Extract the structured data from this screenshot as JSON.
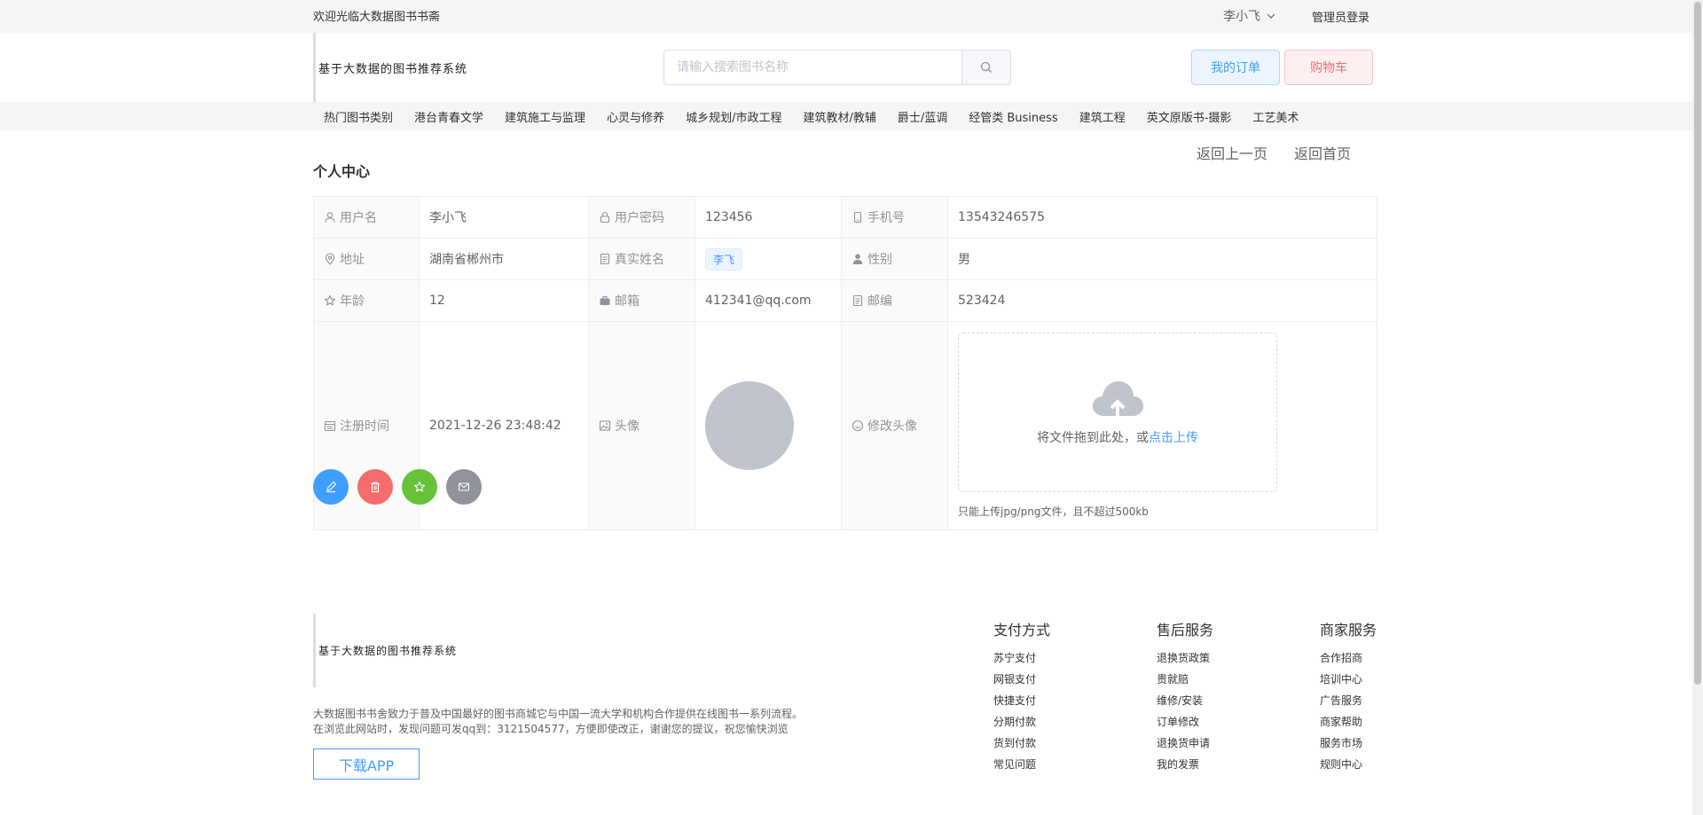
{
  "topbar": {
    "welcome": "欢迎光临大数据图书书斋",
    "username": "李小飞",
    "admin_login": "管理员登录"
  },
  "header": {
    "logo": "基于大数据的图书推荐系统",
    "search_placeholder": "请输入搜索图书名称",
    "orders": "我的订单",
    "cart": "购物车"
  },
  "categories": [
    "热门图书类别",
    "港台青春文学",
    "建筑施工与监理",
    "心灵与修养",
    "城乡规划/市政工程",
    "建筑教材/教辅",
    "爵士/蓝调",
    "经管类 Business",
    "建筑工程",
    "英文原版书-摄影",
    "工艺美术"
  ],
  "page": {
    "title": "个人中心",
    "back": "返回上一页",
    "home": "返回首页"
  },
  "profile": {
    "username_label": "用户名",
    "username": "李小飞",
    "password_label": "用户密码",
    "password": "123456",
    "phone_label": "手机号",
    "phone": "13543246575",
    "address_label": "地址",
    "address": "湖南省郴州市",
    "realname_label": "真实姓名",
    "realname": "李飞",
    "gender_label": "性别",
    "gender": "男",
    "age_label": "年龄",
    "age": "12",
    "email_label": "邮箱",
    "email": "412341@qq.com",
    "zip_label": "邮编",
    "zip": "523424",
    "regtime_label": "注册时间",
    "regtime": "2021-12-26 23:48:42",
    "avatar_label": "头像",
    "change_avatar_label": "修改头像"
  },
  "upload": {
    "text": "将文件拖到此处，或",
    "link": "点击上传",
    "tip": "只能上传jpg/png文件，且不超过500kb"
  },
  "footer": {
    "logo": "基于大数据的图书推荐系统",
    "desc1": "大数据图书书舍致力于普及中国最好的图书商城它与中国一流大学和机构合作提供在线图书一系列流程。",
    "desc2": "在浏览此网站时，发现问题可发qq到：3121504577，方便即使改正，谢谢您的提议，祝您愉快浏览",
    "app_button": "下载APP",
    "columns": [
      {
        "title": "支付方式",
        "links": [
          "苏宁支付",
          "网银支付",
          "快捷支付",
          "分期付款",
          "货到付款",
          "常见问题"
        ]
      },
      {
        "title": "售后服务",
        "links": [
          "退换货政策",
          "贵就赔",
          "维修/安装",
          "订单修改",
          "退换货申请",
          "我的发票"
        ]
      },
      {
        "title": "商家服务",
        "links": [
          "合作招商",
          "培训中心",
          "广告服务",
          "商家帮助",
          "服务市场",
          "规则中心"
        ]
      }
    ]
  }
}
